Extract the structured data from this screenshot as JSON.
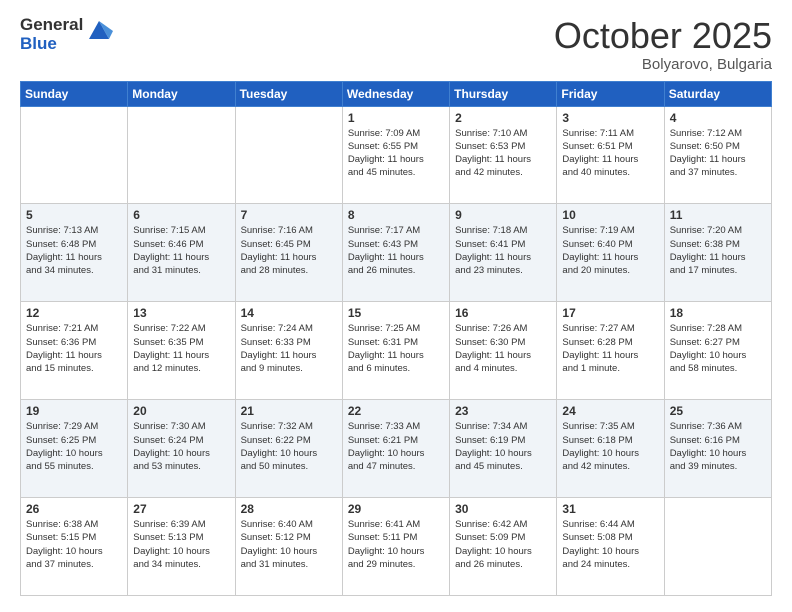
{
  "logo": {
    "general": "General",
    "blue": "Blue"
  },
  "header": {
    "month": "October 2025",
    "location": "Bolyarovo, Bulgaria"
  },
  "weekdays": [
    "Sunday",
    "Monday",
    "Tuesday",
    "Wednesday",
    "Thursday",
    "Friday",
    "Saturday"
  ],
  "weeks": [
    {
      "shade": "white",
      "days": [
        {
          "num": "",
          "info": ""
        },
        {
          "num": "",
          "info": ""
        },
        {
          "num": "",
          "info": ""
        },
        {
          "num": "1",
          "info": "Sunrise: 7:09 AM\nSunset: 6:55 PM\nDaylight: 11 hours\nand 45 minutes."
        },
        {
          "num": "2",
          "info": "Sunrise: 7:10 AM\nSunset: 6:53 PM\nDaylight: 11 hours\nand 42 minutes."
        },
        {
          "num": "3",
          "info": "Sunrise: 7:11 AM\nSunset: 6:51 PM\nDaylight: 11 hours\nand 40 minutes."
        },
        {
          "num": "4",
          "info": "Sunrise: 7:12 AM\nSunset: 6:50 PM\nDaylight: 11 hours\nand 37 minutes."
        }
      ]
    },
    {
      "shade": "shaded",
      "days": [
        {
          "num": "5",
          "info": "Sunrise: 7:13 AM\nSunset: 6:48 PM\nDaylight: 11 hours\nand 34 minutes."
        },
        {
          "num": "6",
          "info": "Sunrise: 7:15 AM\nSunset: 6:46 PM\nDaylight: 11 hours\nand 31 minutes."
        },
        {
          "num": "7",
          "info": "Sunrise: 7:16 AM\nSunset: 6:45 PM\nDaylight: 11 hours\nand 28 minutes."
        },
        {
          "num": "8",
          "info": "Sunrise: 7:17 AM\nSunset: 6:43 PM\nDaylight: 11 hours\nand 26 minutes."
        },
        {
          "num": "9",
          "info": "Sunrise: 7:18 AM\nSunset: 6:41 PM\nDaylight: 11 hours\nand 23 minutes."
        },
        {
          "num": "10",
          "info": "Sunrise: 7:19 AM\nSunset: 6:40 PM\nDaylight: 11 hours\nand 20 minutes."
        },
        {
          "num": "11",
          "info": "Sunrise: 7:20 AM\nSunset: 6:38 PM\nDaylight: 11 hours\nand 17 minutes."
        }
      ]
    },
    {
      "shade": "white",
      "days": [
        {
          "num": "12",
          "info": "Sunrise: 7:21 AM\nSunset: 6:36 PM\nDaylight: 11 hours\nand 15 minutes."
        },
        {
          "num": "13",
          "info": "Sunrise: 7:22 AM\nSunset: 6:35 PM\nDaylight: 11 hours\nand 12 minutes."
        },
        {
          "num": "14",
          "info": "Sunrise: 7:24 AM\nSunset: 6:33 PM\nDaylight: 11 hours\nand 9 minutes."
        },
        {
          "num": "15",
          "info": "Sunrise: 7:25 AM\nSunset: 6:31 PM\nDaylight: 11 hours\nand 6 minutes."
        },
        {
          "num": "16",
          "info": "Sunrise: 7:26 AM\nSunset: 6:30 PM\nDaylight: 11 hours\nand 4 minutes."
        },
        {
          "num": "17",
          "info": "Sunrise: 7:27 AM\nSunset: 6:28 PM\nDaylight: 11 hours\nand 1 minute."
        },
        {
          "num": "18",
          "info": "Sunrise: 7:28 AM\nSunset: 6:27 PM\nDaylight: 10 hours\nand 58 minutes."
        }
      ]
    },
    {
      "shade": "shaded",
      "days": [
        {
          "num": "19",
          "info": "Sunrise: 7:29 AM\nSunset: 6:25 PM\nDaylight: 10 hours\nand 55 minutes."
        },
        {
          "num": "20",
          "info": "Sunrise: 7:30 AM\nSunset: 6:24 PM\nDaylight: 10 hours\nand 53 minutes."
        },
        {
          "num": "21",
          "info": "Sunrise: 7:32 AM\nSunset: 6:22 PM\nDaylight: 10 hours\nand 50 minutes."
        },
        {
          "num": "22",
          "info": "Sunrise: 7:33 AM\nSunset: 6:21 PM\nDaylight: 10 hours\nand 47 minutes."
        },
        {
          "num": "23",
          "info": "Sunrise: 7:34 AM\nSunset: 6:19 PM\nDaylight: 10 hours\nand 45 minutes."
        },
        {
          "num": "24",
          "info": "Sunrise: 7:35 AM\nSunset: 6:18 PM\nDaylight: 10 hours\nand 42 minutes."
        },
        {
          "num": "25",
          "info": "Sunrise: 7:36 AM\nSunset: 6:16 PM\nDaylight: 10 hours\nand 39 minutes."
        }
      ]
    },
    {
      "shade": "white",
      "days": [
        {
          "num": "26",
          "info": "Sunrise: 6:38 AM\nSunset: 5:15 PM\nDaylight: 10 hours\nand 37 minutes."
        },
        {
          "num": "27",
          "info": "Sunrise: 6:39 AM\nSunset: 5:13 PM\nDaylight: 10 hours\nand 34 minutes."
        },
        {
          "num": "28",
          "info": "Sunrise: 6:40 AM\nSunset: 5:12 PM\nDaylight: 10 hours\nand 31 minutes."
        },
        {
          "num": "29",
          "info": "Sunrise: 6:41 AM\nSunset: 5:11 PM\nDaylight: 10 hours\nand 29 minutes."
        },
        {
          "num": "30",
          "info": "Sunrise: 6:42 AM\nSunset: 5:09 PM\nDaylight: 10 hours\nand 26 minutes."
        },
        {
          "num": "31",
          "info": "Sunrise: 6:44 AM\nSunset: 5:08 PM\nDaylight: 10 hours\nand 24 minutes."
        },
        {
          "num": "",
          "info": ""
        }
      ]
    }
  ]
}
